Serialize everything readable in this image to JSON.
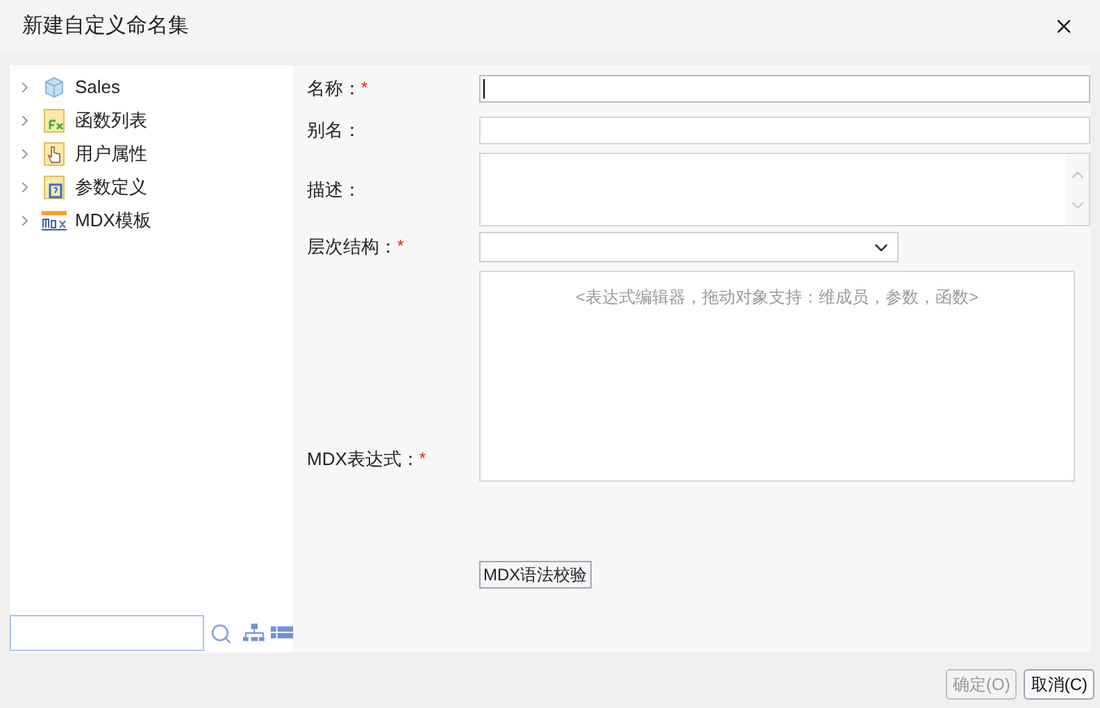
{
  "window": {
    "title": "新建自定义命名集"
  },
  "tree": {
    "items": [
      {
        "label": "Sales",
        "kind": "cube",
        "expanded": false
      },
      {
        "label": "函数列表",
        "kind": "function",
        "expanded": false
      },
      {
        "label": "用户属性",
        "kind": "hand",
        "expanded": false
      },
      {
        "label": "参数定义",
        "kind": "param",
        "expanded": false
      },
      {
        "label": "MDX模板",
        "kind": "mdx",
        "expanded": false
      }
    ]
  },
  "form": {
    "fields": [
      {
        "label": "名称：",
        "required_mark": "*",
        "kind": "text",
        "focused": true
      },
      {
        "label": "别名：",
        "kind": "text",
        "focused": false
      },
      {
        "label": "描述：",
        "kind": "textarea"
      },
      {
        "label": "层次结构：",
        "required_mark": "*",
        "kind": "select"
      },
      {
        "label": "MDX表达式：",
        "required_mark": "*",
        "kind": "editor",
        "placeholder": "<表达式编辑器，拖动对象支持：维成员，参数，函数>"
      }
    ],
    "check_button": "MDX语法校验"
  },
  "buttons": [
    {
      "label": "确定(O)",
      "disabled": true
    },
    {
      "label": "取消(C)",
      "disabled": false
    }
  ]
}
